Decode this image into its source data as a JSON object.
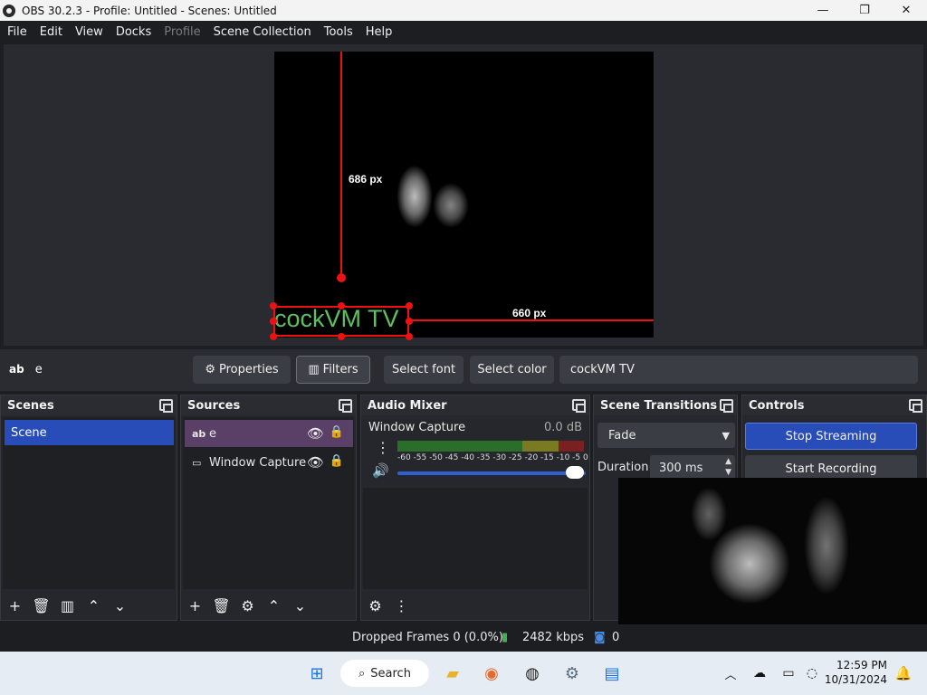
{
  "window": {
    "title": "OBS 30.2.3 - Profile: Untitled - Scenes: Untitled",
    "minimize": "—",
    "restore": "❐",
    "close": "✕"
  },
  "menu": [
    "File",
    "Edit",
    "View",
    "Docks",
    "Profile",
    "Scene Collection",
    "Tools",
    "Help"
  ],
  "preview": {
    "vertical_measure": "686 px",
    "horizontal_measure": "660 px",
    "selected_text": "cockVM TV"
  },
  "context_bar": {
    "source_type": "ab",
    "source_name": "e",
    "properties": "Properties",
    "filters": "Filters",
    "select_font": "Select font",
    "select_color": "Select color",
    "text_value": "cockVM TV"
  },
  "scenes": {
    "title": "Scenes",
    "items": [
      "Scene"
    ]
  },
  "sources": {
    "title": "Sources",
    "items": [
      {
        "type": "ab",
        "name": "e"
      },
      {
        "type": "window",
        "name": "Window Capture"
      }
    ]
  },
  "audio_mixer": {
    "title": "Audio Mixer",
    "channel_name": "Window Capture",
    "db_value": "0.0 dB",
    "ticks": "-60 -55 -50 -45 -40 -35 -30 -25 -20 -15 -10  -5   0",
    "volume_fraction": 0.95
  },
  "transitions": {
    "title": "Scene Transitions",
    "selected": "Fade",
    "duration_label": "Duration",
    "duration_value": "300 ms"
  },
  "controls": {
    "title": "Controls",
    "stop_streaming": "Stop Streaming",
    "start_recording": "Start Recording"
  },
  "status": {
    "dropped_frames": "Dropped Frames 0 (0.0%)",
    "bitrate": "2482 kbps",
    "extra": "0"
  },
  "taskbar": {
    "search": "Search",
    "time": "12:59 PM",
    "date": "10/31/2024"
  },
  "colors": {
    "accent_blue": "#284cb8",
    "selection_red": "#ee1111",
    "text_green": "#5ec05e",
    "source_selected": "#5a3f66"
  }
}
